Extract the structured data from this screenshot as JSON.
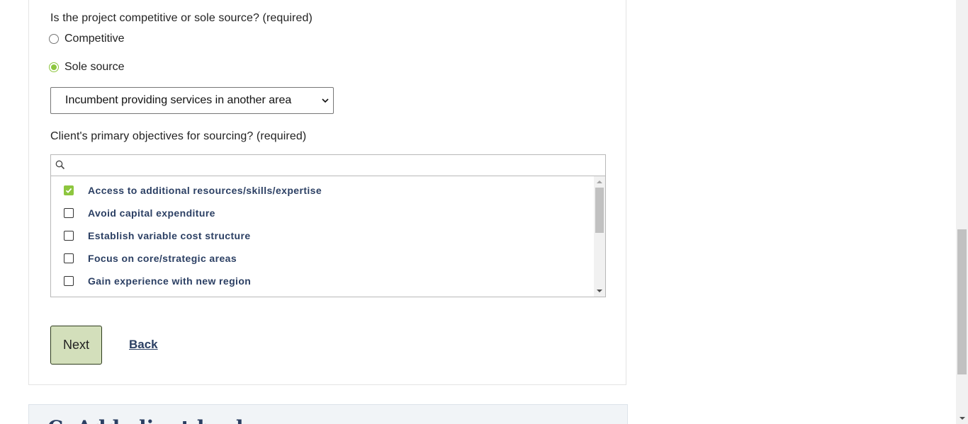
{
  "form": {
    "q_competitive": "Is the project competitive or sole source? (required)",
    "radios": [
      {
        "label": "Competitive",
        "checked": false
      },
      {
        "label": "Sole source",
        "checked": true
      }
    ],
    "sole_source_reason": "Incumbent providing services in another area",
    "q_objectives": "Client's primary objectives for sourcing? (required)",
    "search": {
      "value": ""
    },
    "objectives": [
      {
        "label": "Access to additional resources/skills/expertise",
        "checked": true
      },
      {
        "label": "Avoid capital expenditure",
        "checked": false
      },
      {
        "label": "Establish variable cost structure",
        "checked": false
      },
      {
        "label": "Focus on core/strategic areas",
        "checked": false
      },
      {
        "label": "Gain experience with new region",
        "checked": false
      }
    ],
    "next_label": "Next",
    "back_label": "Back"
  },
  "next_section": {
    "title": "C. Add client back"
  },
  "colors": {
    "accent_green": "#8dc63f",
    "next_button_bg": "#d3dfbb",
    "link_navy": "#2b3f63"
  }
}
